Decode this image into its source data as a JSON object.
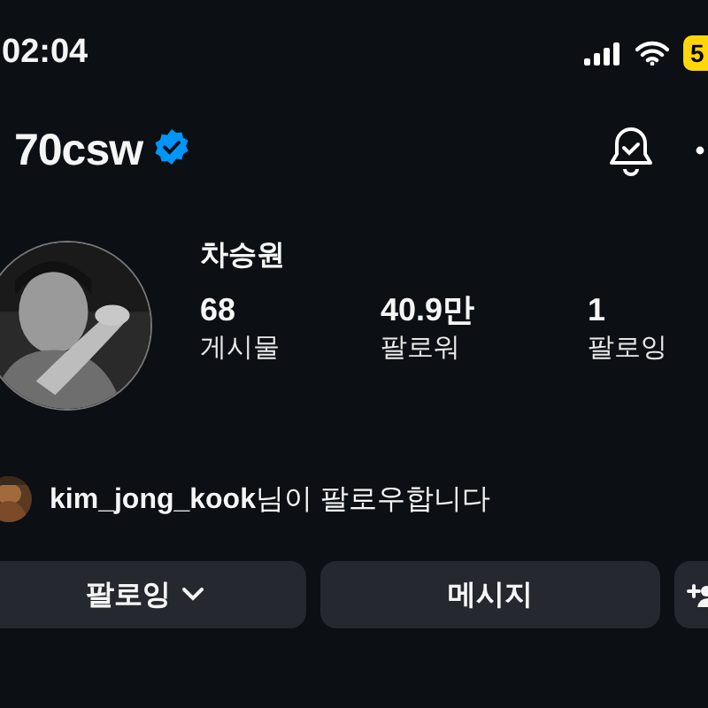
{
  "status_bar": {
    "time": "02:04",
    "battery": "5"
  },
  "header": {
    "username": "70csw",
    "verified": true
  },
  "profile": {
    "name": "차승원",
    "stats": [
      {
        "count": "68",
        "label": "게시물"
      },
      {
        "count": "40.9만",
        "label": "팔로워"
      },
      {
        "count": "1",
        "label": "팔로잉"
      }
    ]
  },
  "followed_by": {
    "text": "**kim_jong_kook**님이 팔로우합니다"
  },
  "buttons": [
    {
      "kind": "dropdown",
      "label": "팔로잉"
    },
    {
      "kind": "plain",
      "label": "메시지"
    },
    {
      "kind": "icon"
    }
  ]
}
